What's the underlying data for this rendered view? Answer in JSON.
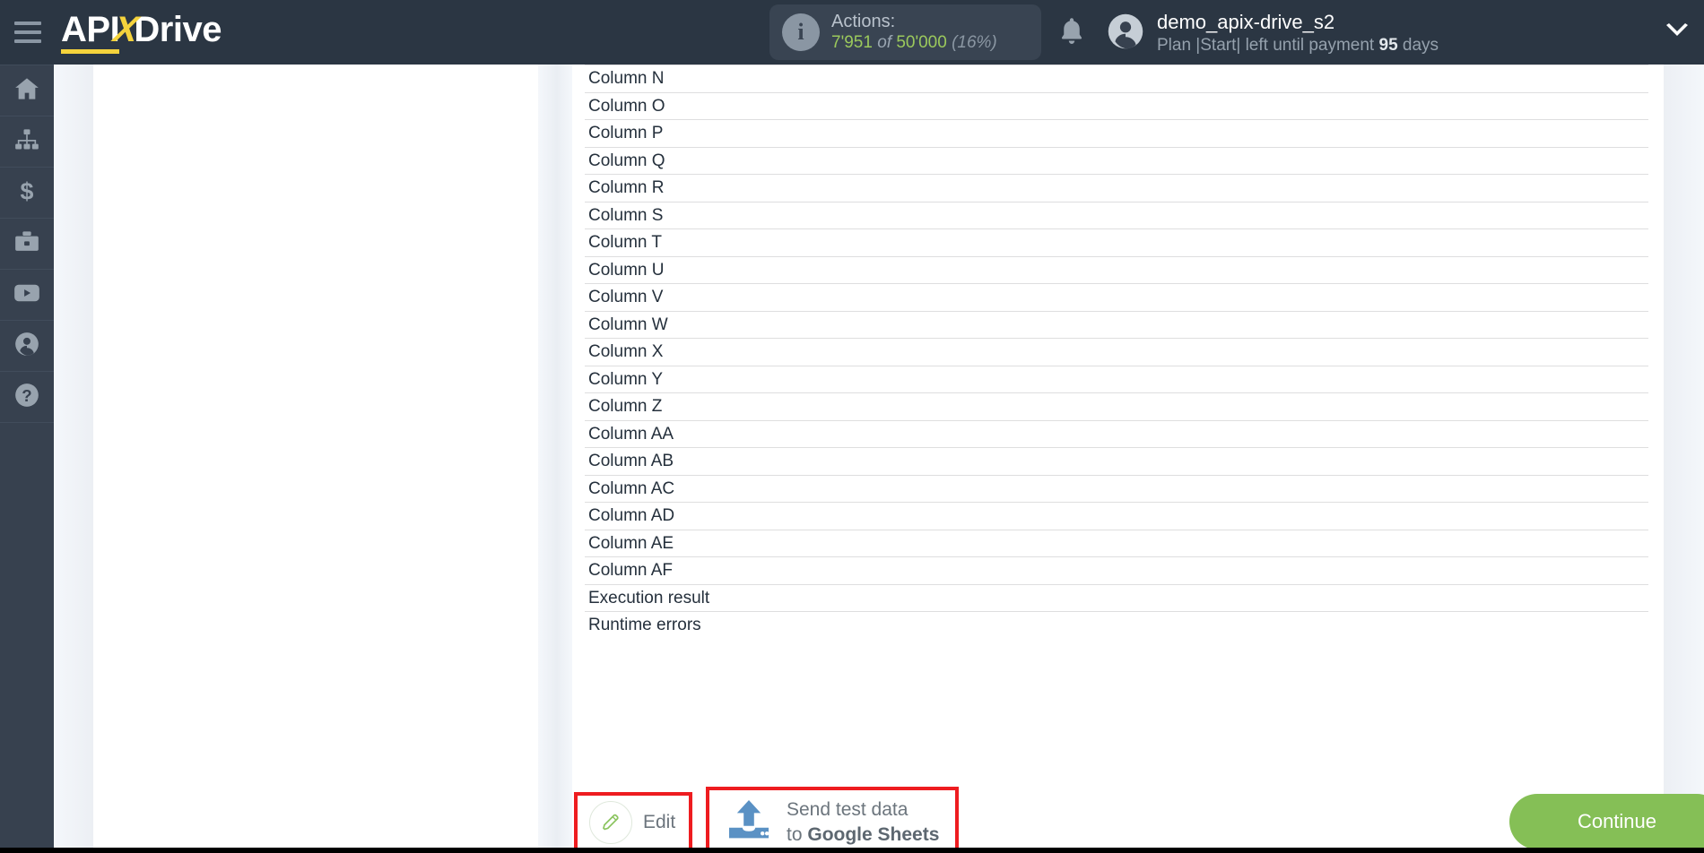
{
  "header": {
    "menu_icon": "hamburger-icon",
    "logo": {
      "part1": "API",
      "accent": "X",
      "part2": "Drive"
    },
    "actions": {
      "icon": "info-icon",
      "title": "Actions:",
      "used": "7'951",
      "of_label": "of",
      "total": "50'000",
      "percent": "(16%)"
    },
    "notifications_icon": "bell-icon",
    "user": {
      "avatar_icon": "user-avatar-icon",
      "name": "demo_apix-drive_s2",
      "plan_prefix": "Plan |Start| left until payment ",
      "plan_days": "95",
      "plan_suffix": " days",
      "dropdown_icon": "chevron-down-icon"
    }
  },
  "sidebar": {
    "items": [
      {
        "icon": "home-icon",
        "name": "sidebar-item-home"
      },
      {
        "icon": "sitemap-icon",
        "name": "sidebar-item-connections"
      },
      {
        "icon": "dollar-icon",
        "name": "sidebar-item-billing"
      },
      {
        "icon": "briefcase-icon",
        "name": "sidebar-item-business"
      },
      {
        "icon": "youtube-icon",
        "name": "sidebar-item-video"
      },
      {
        "icon": "account-icon",
        "name": "sidebar-item-account"
      },
      {
        "icon": "help-icon",
        "name": "sidebar-item-help"
      }
    ]
  },
  "fields": [
    "Column N",
    "Column O",
    "Column P",
    "Column Q",
    "Column R",
    "Column S",
    "Column T",
    "Column U",
    "Column V",
    "Column W",
    "Column X",
    "Column Y",
    "Column Z",
    "Column AA",
    "Column AB",
    "Column AC",
    "Column AD",
    "Column AE",
    "Column AF",
    "Execution result",
    "Runtime errors"
  ],
  "action_bar": {
    "edit": {
      "label": "Edit",
      "icon": "pencil-icon"
    },
    "send_test": {
      "icon": "upload-icon",
      "line1": "Send test data",
      "line2_prefix": "to ",
      "line2_bold": "Google Sheets"
    },
    "continue": {
      "label": "Continue"
    }
  },
  "colors": {
    "header_bg": "#2b3643",
    "sidebar_bg": "#37414f",
    "accent_yellow": "#f5d33c",
    "green_button": "#85bf56",
    "highlight_red": "#ee1c20",
    "counter_green": "#9bc95c",
    "upload_blue": "#5a91c4"
  }
}
